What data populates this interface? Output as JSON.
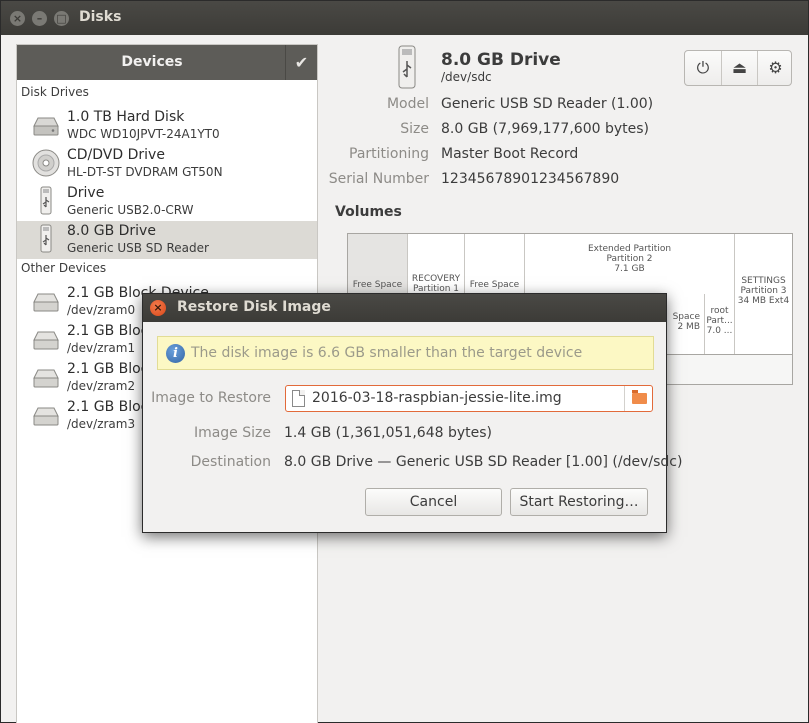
{
  "window": {
    "title": "Disks",
    "controls": [
      "close-icon",
      "minimize-icon",
      "maximize-icon"
    ]
  },
  "sidebar": {
    "header": "Devices",
    "section_disk_drives": "Disk Drives",
    "section_other_devices": "Other Devices",
    "disk_drives": [
      {
        "name": "1.0 TB Hard Disk",
        "sub": "WDC WD10JPVT-24A1YT0",
        "icon": "hard-disk-icon"
      },
      {
        "name": "CD/DVD Drive",
        "sub": "HL-DT-ST DVDRAM GT50N",
        "icon": "optical-drive-icon"
      },
      {
        "name": "Drive",
        "sub": "Generic USB2.0-CRW",
        "icon": "usb-drive-icon"
      },
      {
        "name": "8.0 GB Drive",
        "sub": "Generic USB  SD Reader",
        "icon": "usb-drive-icon",
        "selected": true
      }
    ],
    "other_devices": [
      {
        "name": "2.1 GB Block Device",
        "sub": "/dev/zram0",
        "icon": "block-device-icon"
      },
      {
        "name": "2.1 GB Block Device",
        "sub": "/dev/zram1",
        "icon": "block-device-icon"
      },
      {
        "name": "2.1 GB Block Device",
        "sub": "/dev/zram2",
        "icon": "block-device-icon"
      },
      {
        "name": "2.1 GB Block Device",
        "sub": "/dev/zram3",
        "icon": "block-device-icon"
      }
    ]
  },
  "drive": {
    "title": "8.0 GB Drive",
    "path": "/dev/sdc",
    "properties": [
      {
        "label": "Model",
        "value": "Generic USB  SD Reader (1.00)"
      },
      {
        "label": "Size",
        "value": "8.0 GB (7,969,177,600 bytes)"
      },
      {
        "label": "Partitioning",
        "value": "Master Boot Record"
      },
      {
        "label": "Serial Number",
        "value": "12345678901234567890"
      }
    ],
    "toolbar": [
      "power-icon",
      "eject-icon",
      "gear-icon"
    ]
  },
  "volumes": {
    "heading": "Volumes",
    "free_space_1": "Free Space",
    "recovery": "RECOVERY",
    "recovery_sub": "Partition 1",
    "free_space_2": "Free Space",
    "extended_title": "Extended Partition",
    "extended_sub": "Partition 2",
    "extended_size": "7.1 GB",
    "sub_free_space": "Space",
    "sub_free_size": "2 MB",
    "root_name": "root",
    "root_sub": "Part...",
    "root_size": "7.0 ...",
    "settings_name": "SETTINGS",
    "settings_sub": "Partition 3",
    "settings_size": "34 MB Ext4"
  },
  "dialog": {
    "title": "Restore Disk Image",
    "info": "The disk image is 6.6 GB smaller than the target device",
    "image_label": "Image to Restore",
    "image_file": "2016-03-18-raspbian-jessie-lite.img",
    "size_label": "Image Size",
    "size_value": "1.4 GB (1,361,051,648 bytes)",
    "destination_label": "Destination",
    "destination_value": "8.0 GB Drive — Generic USB  SD Reader [1.00] (/dev/sdc)",
    "cancel": "Cancel",
    "start": "Start Restoring…"
  }
}
